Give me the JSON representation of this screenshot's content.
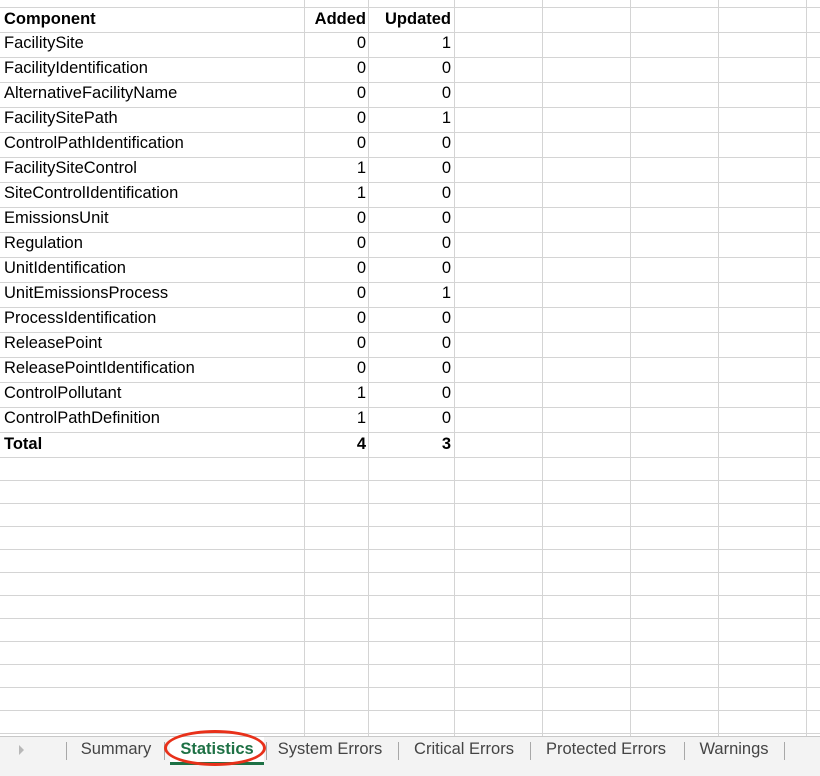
{
  "table": {
    "headers": {
      "component": "Component",
      "added": "Added",
      "updated": "Updated"
    },
    "rows": [
      {
        "component": "FacilitySite",
        "added": "0",
        "updated": "1"
      },
      {
        "component": "FacilityIdentification",
        "added": "0",
        "updated": "0"
      },
      {
        "component": "AlternativeFacilityName",
        "added": "0",
        "updated": "0"
      },
      {
        "component": "FacilitySitePath",
        "added": "0",
        "updated": "1"
      },
      {
        "component": "ControlPathIdentification",
        "added": "0",
        "updated": "0"
      },
      {
        "component": "FacilitySiteControl",
        "added": "1",
        "updated": "0"
      },
      {
        "component": "SiteControlIdentification",
        "added": "1",
        "updated": "0"
      },
      {
        "component": "EmissionsUnit",
        "added": "0",
        "updated": "0"
      },
      {
        "component": "Regulation",
        "added": "0",
        "updated": "0"
      },
      {
        "component": "UnitIdentification",
        "added": "0",
        "updated": "0"
      },
      {
        "component": "UnitEmissionsProcess",
        "added": "0",
        "updated": "1"
      },
      {
        "component": "ProcessIdentification",
        "added": "0",
        "updated": "0"
      },
      {
        "component": "ReleasePoint",
        "added": "0",
        "updated": "0"
      },
      {
        "component": "ReleasePointIdentification",
        "added": "0",
        "updated": "0"
      },
      {
        "component": "ControlPollutant",
        "added": "1",
        "updated": "0"
      },
      {
        "component": "ControlPathDefinition",
        "added": "1",
        "updated": "0"
      }
    ],
    "total": {
      "component": "Total",
      "added": "4",
      "updated": "3"
    }
  },
  "sheet_tabs": [
    {
      "label": "Summary",
      "active": false
    },
    {
      "label": "Statistics",
      "active": true
    },
    {
      "label": "System Errors",
      "active": false
    },
    {
      "label": "Critical Errors",
      "active": false
    },
    {
      "label": "Protected Errors",
      "active": false
    },
    {
      "label": "Warnings",
      "active": false
    }
  ],
  "colors": {
    "active_tab": "#1e7145",
    "highlight_circle": "#e8311a",
    "gridline": "#d4d4d4"
  }
}
